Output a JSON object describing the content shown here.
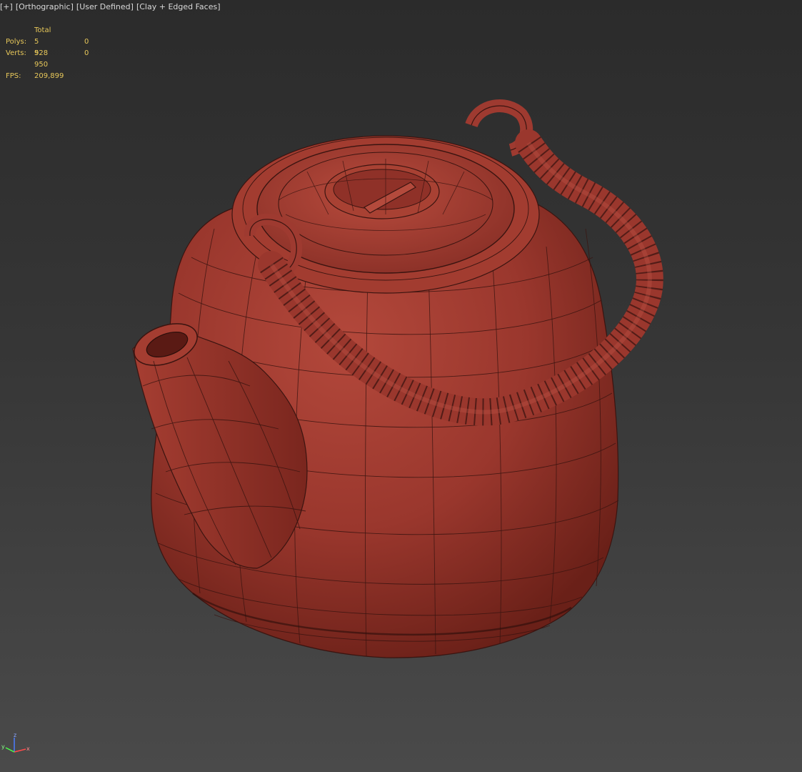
{
  "viewport": {
    "label_plus": "[+]",
    "label_view": "[Orthographic]",
    "label_camera": "[User Defined]",
    "label_shading": "[Clay + Edged Faces]"
  },
  "stats": {
    "total_header": "Total",
    "polys_label": "Polys:",
    "polys_total": "5 928",
    "polys_selected": "0",
    "verts_label": "Verts:",
    "verts_total": "5 950",
    "verts_selected": "0",
    "fps_label": "FPS:",
    "fps_value": "209,899"
  },
  "model": {
    "name": "teapot-mesh",
    "clay_color": "#9e3a30",
    "edge_color": "#3a1410"
  },
  "axis_gizmo": {
    "x": "x",
    "y": "y",
    "z": "z"
  },
  "colors": {
    "stats_text": "#e8c85a",
    "label_text": "#d8d8d8",
    "bg_top": "#2b2b2b",
    "bg_bottom": "#4a4a4a"
  }
}
